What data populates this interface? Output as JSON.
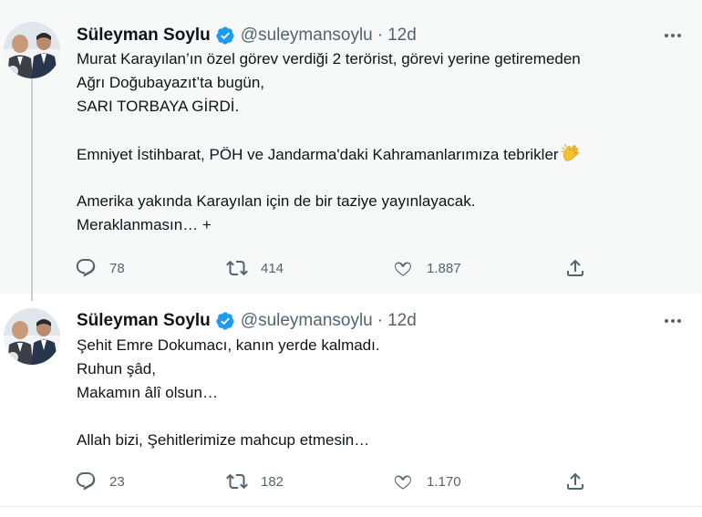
{
  "tweets": [
    {
      "author": {
        "name": "Süleyman Soylu",
        "handle": "@suleymansoylu",
        "separator": "·",
        "time": "12d"
      },
      "lines": [
        "Murat Karayılan’ın özel görev verdiği 2 terörist, görevi yerine getiremeden",
        "Ağrı Doğubayazıt’ta bugün,",
        "SARI TORBAYA GİRDİ.",
        "",
        "Emniyet İstihbarat, PÖH ve Jandarma'daki Kahramanlarımıza tebrikler",
        "",
        "Amerika yakında Karayılan için de bir taziye yayınlayacak.",
        "Meraklanmasın… +"
      ],
      "stats": {
        "replies": "78",
        "retweets": "414",
        "likes": "1.887"
      }
    },
    {
      "author": {
        "name": "Süleyman Soylu",
        "handle": "@suleymansoylu",
        "separator": "·",
        "time": "12d"
      },
      "lines": [
        "Şehit Emre Dokumacı, kanın yerde kalmadı.",
        "Ruhun şâd,",
        "Makamın âlî olsun…",
        "",
        "Allah bizi, Şehitlerimize mahcup etmesin…"
      ],
      "stats": {
        "replies": "23",
        "retweets": "182",
        "likes": "1.170"
      }
    }
  ],
  "icons": {
    "verified": "verified-badge-icon",
    "more": "more-dots-icon",
    "reply": "reply-icon",
    "retweet": "retweet-icon",
    "like": "heart-icon",
    "share": "share-icon",
    "clap": "clapping-hands-emoji"
  },
  "colors": {
    "verified": "#1d9bf0",
    "muted": "#536471",
    "text": "#0f1419",
    "thread_line": "#c4cfd6",
    "hover_bg": "#f7f9f9"
  }
}
